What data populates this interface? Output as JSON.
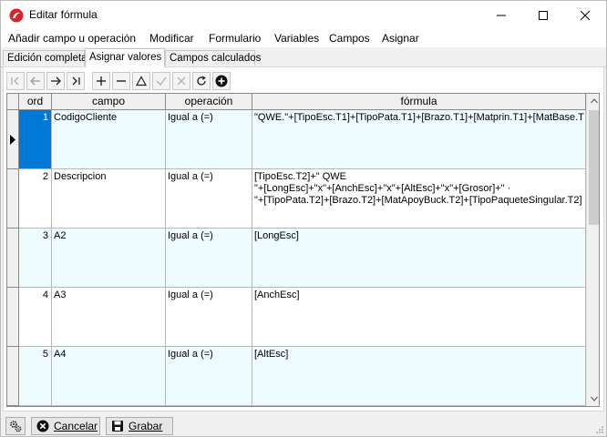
{
  "window": {
    "title": "Editar fórmula"
  },
  "menu": [
    "Añadir campo u operación",
    "Modificar",
    "Formulario",
    "Variables",
    "Campos",
    "Asignar"
  ],
  "tabs": [
    "Edición completa",
    "Asignar valores",
    "Campos calculados"
  ],
  "active_tab": "Asignar valores",
  "toolbar": {
    "buttons": [
      "first-icon",
      "prev-icon",
      "next-icon",
      "last-icon",
      "insert-icon",
      "delete-icon",
      "edit-icon",
      "post-icon",
      "cancel-icon",
      "refresh-icon",
      "add-circle-icon"
    ]
  },
  "grid": {
    "columns": [
      "ord",
      "campo",
      "operación",
      "fórmula"
    ],
    "rows": [
      {
        "ord": "1",
        "campo": "CodigoCliente",
        "operacion": "Igual a (=)",
        "formula": "\"QWE.\"+[TipoEsc.T1]+[TipoPata.T1]+[Brazo.T1]+[Matprin.T1]+[MatBase.T",
        "current": true
      },
      {
        "ord": "2",
        "campo": "Descripcion",
        "operacion": "Igual a (=)",
        "formula": "[TipoEsc.T2]+\" QWE\n\"+[LongEsc]+\"x\"+[AnchEsc]+\"x\"+[AltEsc]+\"x\"+[Grosor]+\" ·\n\"+[TipoPata.T2]+[Brazo.T2]+[MatApoyBuck.T2]+[TipoPaqueteSingular.T2]"
      },
      {
        "ord": "3",
        "campo": "A2",
        "operacion": "Igual a (=)",
        "formula": "[LongEsc]"
      },
      {
        "ord": "4",
        "campo": "A3",
        "operacion": "Igual a (=)",
        "formula": "[AnchEsc]"
      },
      {
        "ord": "5",
        "campo": "A4",
        "operacion": "Igual a (=)",
        "formula": "[AltEsc]"
      }
    ]
  },
  "footer": {
    "cancel_label": "Cancelar",
    "save_label": "Grabar"
  },
  "colors": {
    "selection": "#0078d7",
    "row_tint": "#eefcff"
  }
}
